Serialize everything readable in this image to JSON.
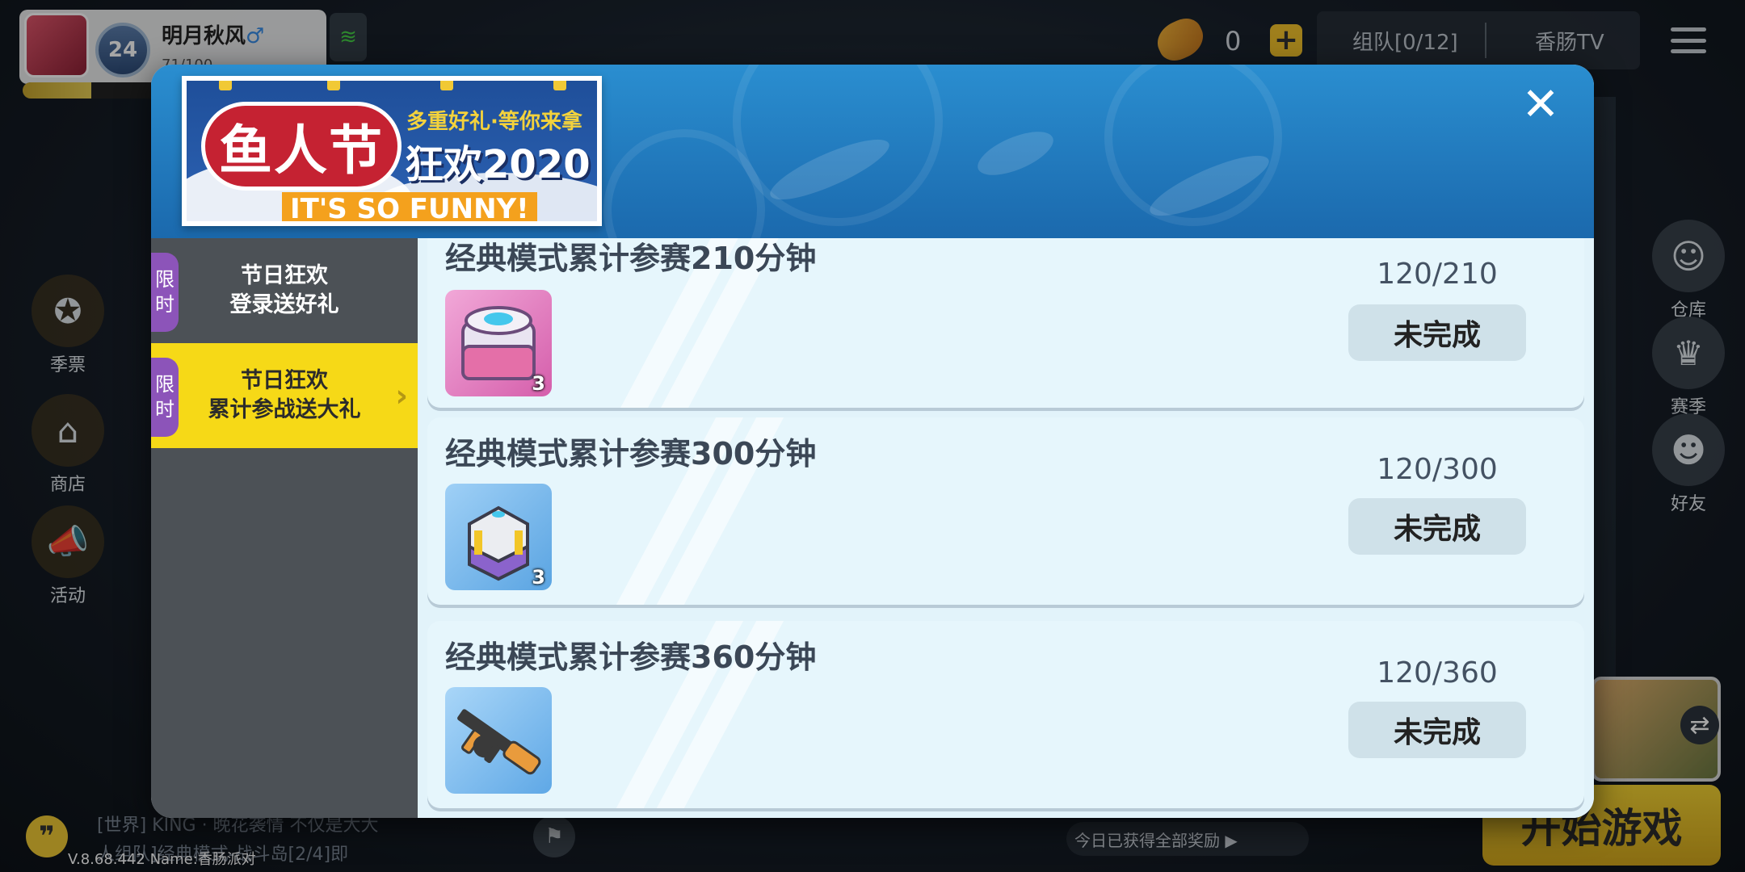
{
  "player": {
    "name": "明月秋风",
    "gender_symbol": "♂",
    "level": "24",
    "sub_text": "71/100",
    "xp_fraction": 0.5
  },
  "topbar": {
    "currency_value": "0",
    "plus_label": "+",
    "team_label": "组队[0/12]",
    "tv_label": "香肠TV"
  },
  "side_left": [
    {
      "label": "季票",
      "icon": "medal-icon"
    },
    {
      "label": "商店",
      "icon": "shop-icon"
    },
    {
      "label": "活动",
      "icon": "megaphone-icon"
    }
  ],
  "side_right": [
    {
      "label": "仓库",
      "icon": "warehouse-icon"
    },
    {
      "label": "赛季",
      "icon": "season-icon"
    },
    {
      "label": "好友",
      "icon": "friends-icon"
    }
  ],
  "bottom": {
    "start_label": "开始游戏",
    "reward_strip": "今日已获得全部奖励 ▶",
    "chat_line_1": "[世界] KING · 晚花袭情 不仅是大大",
    "chat_line_2": "人组队]经典模式-战斗岛[2/4]即",
    "version": "V.8.68.442 Name:香肠派对"
  },
  "banner": {
    "title": "鱼人节",
    "slogan": "多重好礼·等你来拿",
    "sub": "狂欢2020",
    "funny": "IT'S SO FUNNY!"
  },
  "sidebar": {
    "items": [
      {
        "tag_1": "限",
        "tag_2": "时",
        "line1": "节日狂欢",
        "line2": "登录送好礼",
        "active": false
      },
      {
        "tag_1": "限",
        "tag_2": "时",
        "line1": "节日狂欢",
        "line2": "累计参战送大礼",
        "active": true
      }
    ]
  },
  "tasks": [
    {
      "title": "经典模式累计参赛210分钟",
      "progress": "120/210",
      "status": "未完成",
      "reward_count": "3",
      "reward_icon": "pink-crate-icon"
    },
    {
      "title": "经典模式累计参赛300分钟",
      "progress": "120/300",
      "status": "未完成",
      "reward_count": "3",
      "reward_icon": "purple-crate-icon"
    },
    {
      "title": "经典模式累计参赛360分钟",
      "progress": "120/360",
      "status": "未完成",
      "reward_count": "",
      "reward_icon": "tommy-gun-icon"
    }
  ],
  "colors": {
    "accent_yellow": "#f6d917",
    "tag_purple": "#8c54b9",
    "header_blue": "#1b69ad",
    "card_bg": "#e6f6fc"
  }
}
